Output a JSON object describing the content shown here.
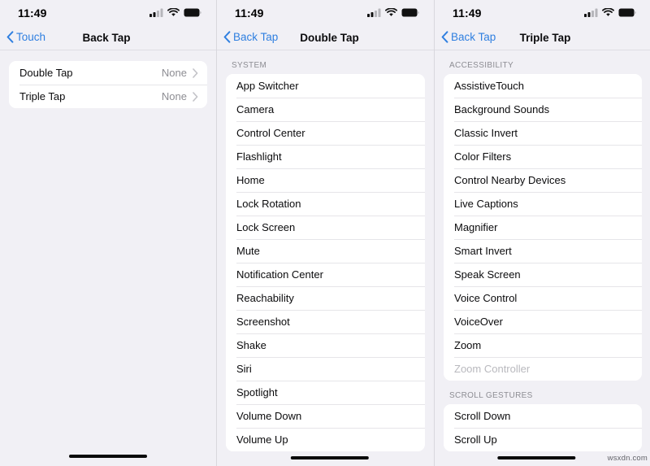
{
  "statusbar": {
    "time": "11:49",
    "icons": [
      "cellular-signal-icon",
      "wifi-icon",
      "battery-icon"
    ]
  },
  "screens": [
    {
      "id": "back-tap",
      "nav": {
        "back_label": "Touch",
        "title": "Back Tap",
        "back_icon": "chevron-left-icon"
      },
      "sections": [
        {
          "header": "",
          "rows": [
            {
              "label": "Double Tap",
              "value": "None",
              "accessory": "chevron-right-icon",
              "disabled": false
            },
            {
              "label": "Triple Tap",
              "value": "None",
              "accessory": "chevron-right-icon",
              "disabled": false
            }
          ]
        }
      ]
    },
    {
      "id": "double-tap",
      "nav": {
        "back_label": "Back Tap",
        "title": "Double Tap",
        "back_icon": "chevron-left-icon"
      },
      "sections": [
        {
          "header": "SYSTEM",
          "rows": [
            {
              "label": "App Switcher",
              "value": "",
              "accessory": "",
              "disabled": false
            },
            {
              "label": "Camera",
              "value": "",
              "accessory": "",
              "disabled": false
            },
            {
              "label": "Control Center",
              "value": "",
              "accessory": "",
              "disabled": false
            },
            {
              "label": "Flashlight",
              "value": "",
              "accessory": "",
              "disabled": false
            },
            {
              "label": "Home",
              "value": "",
              "accessory": "",
              "disabled": false
            },
            {
              "label": "Lock Rotation",
              "value": "",
              "accessory": "",
              "disabled": false
            },
            {
              "label": "Lock Screen",
              "value": "",
              "accessory": "",
              "disabled": false
            },
            {
              "label": "Mute",
              "value": "",
              "accessory": "",
              "disabled": false
            },
            {
              "label": "Notification Center",
              "value": "",
              "accessory": "",
              "disabled": false
            },
            {
              "label": "Reachability",
              "value": "",
              "accessory": "",
              "disabled": false
            },
            {
              "label": "Screenshot",
              "value": "",
              "accessory": "",
              "disabled": false
            },
            {
              "label": "Shake",
              "value": "",
              "accessory": "",
              "disabled": false
            },
            {
              "label": "Siri",
              "value": "",
              "accessory": "",
              "disabled": false
            },
            {
              "label": "Spotlight",
              "value": "",
              "accessory": "",
              "disabled": false
            },
            {
              "label": "Volume Down",
              "value": "",
              "accessory": "",
              "disabled": false
            },
            {
              "label": "Volume Up",
              "value": "",
              "accessory": "",
              "disabled": false
            }
          ]
        }
      ]
    },
    {
      "id": "triple-tap",
      "nav": {
        "back_label": "Back Tap",
        "title": "Triple Tap",
        "back_icon": "chevron-left-icon"
      },
      "sections": [
        {
          "header": "ACCESSIBILITY",
          "rows": [
            {
              "label": "AssistiveTouch",
              "value": "",
              "accessory": "",
              "disabled": false
            },
            {
              "label": "Background Sounds",
              "value": "",
              "accessory": "",
              "disabled": false
            },
            {
              "label": "Classic Invert",
              "value": "",
              "accessory": "",
              "disabled": false
            },
            {
              "label": "Color Filters",
              "value": "",
              "accessory": "",
              "disabled": false
            },
            {
              "label": "Control Nearby Devices",
              "value": "",
              "accessory": "",
              "disabled": false
            },
            {
              "label": "Live Captions",
              "value": "",
              "accessory": "",
              "disabled": false
            },
            {
              "label": "Magnifier",
              "value": "",
              "accessory": "",
              "disabled": false
            },
            {
              "label": "Smart Invert",
              "value": "",
              "accessory": "",
              "disabled": false
            },
            {
              "label": "Speak Screen",
              "value": "",
              "accessory": "",
              "disabled": false
            },
            {
              "label": "Voice Control",
              "value": "",
              "accessory": "",
              "disabled": false
            },
            {
              "label": "VoiceOver",
              "value": "",
              "accessory": "",
              "disabled": false
            },
            {
              "label": "Zoom",
              "value": "",
              "accessory": "",
              "disabled": false
            },
            {
              "label": "Zoom Controller",
              "value": "",
              "accessory": "",
              "disabled": true
            }
          ]
        },
        {
          "header": "SCROLL GESTURES",
          "rows": [
            {
              "label": "Scroll Down",
              "value": "",
              "accessory": "",
              "disabled": false
            },
            {
              "label": "Scroll Up",
              "value": "",
              "accessory": "",
              "disabled": false
            }
          ]
        }
      ]
    }
  ],
  "watermark": "wsxdn.com",
  "colors": {
    "accent": "#2f7fe0",
    "background": "#f1f0f5",
    "cell": "#ffffff",
    "secondary_text": "#8d8d93",
    "disabled_text": "#b9b9be"
  }
}
